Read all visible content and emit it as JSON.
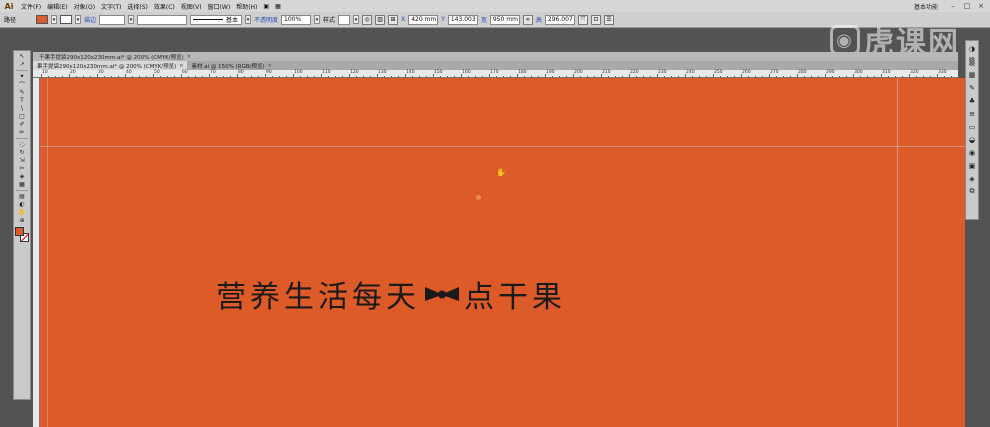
{
  "app": {
    "logo": "Ai",
    "menu": [
      "文件(F)",
      "编辑(E)",
      "对象(O)",
      "文字(T)",
      "选择(S)",
      "效果(C)",
      "视图(V)",
      "窗口(W)",
      "帮助(H)"
    ],
    "workspace_label": "基本功能",
    "window_buttons": [
      "–",
      "□",
      "×"
    ]
  },
  "controlbar": {
    "selection_label": "路径",
    "fill_color": "#d95a2b",
    "stroke_label": "描边",
    "brush_label": "基本",
    "opacity_label": "不透明度",
    "opacity_value": "100%",
    "style_label": "样式",
    "x_label": "X",
    "x_value": "420 mm",
    "y_label": "Y",
    "y_value": "143.003",
    "w_label": "宽",
    "w_value": "950 mm",
    "h_label": "高",
    "h_value": "296.007"
  },
  "tabs": {
    "row1": [
      {
        "label": "干果手提袋290x120x230mm.ai* @ 200% (CMYK/预览)",
        "active": false
      }
    ],
    "row2": [
      {
        "label": "果手提袋290x120x230mm.ai* @ 200% (CMYK/预览)",
        "active": true
      },
      {
        "label": "素材.ai @ 150% (RGB/预览)",
        "active": false
      }
    ]
  },
  "ruler": {
    "labels": [
      "10",
      "20",
      "30",
      "40",
      "50",
      "60",
      "70",
      "80",
      "90",
      "100",
      "110",
      "120",
      "130",
      "140",
      "150",
      "160",
      "170",
      "180",
      "190",
      "200",
      "210",
      "220",
      "230",
      "240",
      "250",
      "260",
      "270",
      "280",
      "290",
      "300",
      "310",
      "320",
      "330"
    ]
  },
  "canvas": {
    "background": "#dd5a29",
    "headline_part1": "营养生活每天",
    "headline_part2": "点干果",
    "text_color": "#1a1a1a"
  },
  "watermark": {
    "text": "虎课网"
  },
  "toolbox": {
    "tools": [
      "↖",
      "↗",
      "✦",
      "⌒",
      "✎",
      "T",
      "\\",
      "□",
      "✐",
      "✏",
      "◌",
      "↻",
      "⇲",
      "✂",
      "◈",
      "▦",
      "▤",
      "◐",
      "✋",
      "⊕"
    ]
  }
}
